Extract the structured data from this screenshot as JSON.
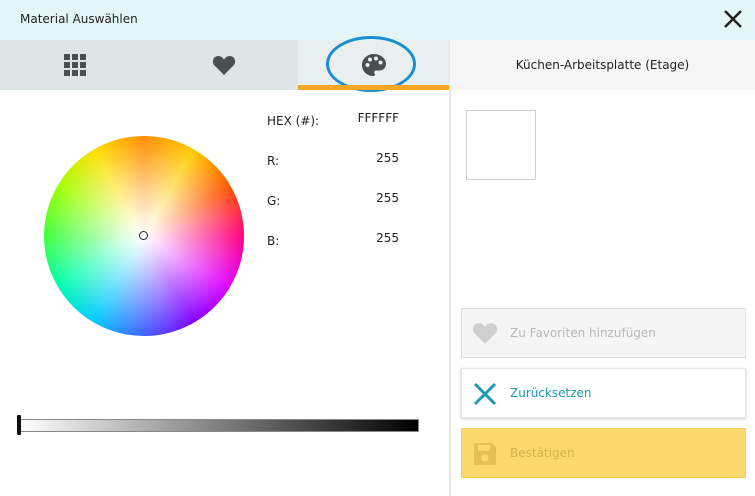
{
  "window": {
    "title": "Material Auswählen"
  },
  "tabs": [
    {
      "icon": "grid-icon",
      "active": false
    },
    {
      "icon": "heart-icon",
      "active": false
    },
    {
      "icon": "palette-icon",
      "active": true
    }
  ],
  "colors": {
    "titlebar_bg": "#e4f5f8",
    "tab_accent": "#f5a623",
    "highlight_ring": "#1a8fd0",
    "reset_accent": "#1a9bb5",
    "confirm_bg": "#fdd86c"
  },
  "picker": {
    "hex_label": "HEX (#):",
    "hex_value": "FFFFFF",
    "r_label": "R:",
    "r_value": "255",
    "g_label": "G:",
    "g_value": "255",
    "b_label": "B:",
    "b_value": "255",
    "brightness_level": 0
  },
  "right": {
    "material_name": "Küchen-Arbeitsplatte (Etage)",
    "preview_color": "#FFFFFF",
    "favorite_label": "Zu Favoriten hinzufügen",
    "reset_label": "Zurücksetzen",
    "confirm_label": "Bestätigen"
  }
}
